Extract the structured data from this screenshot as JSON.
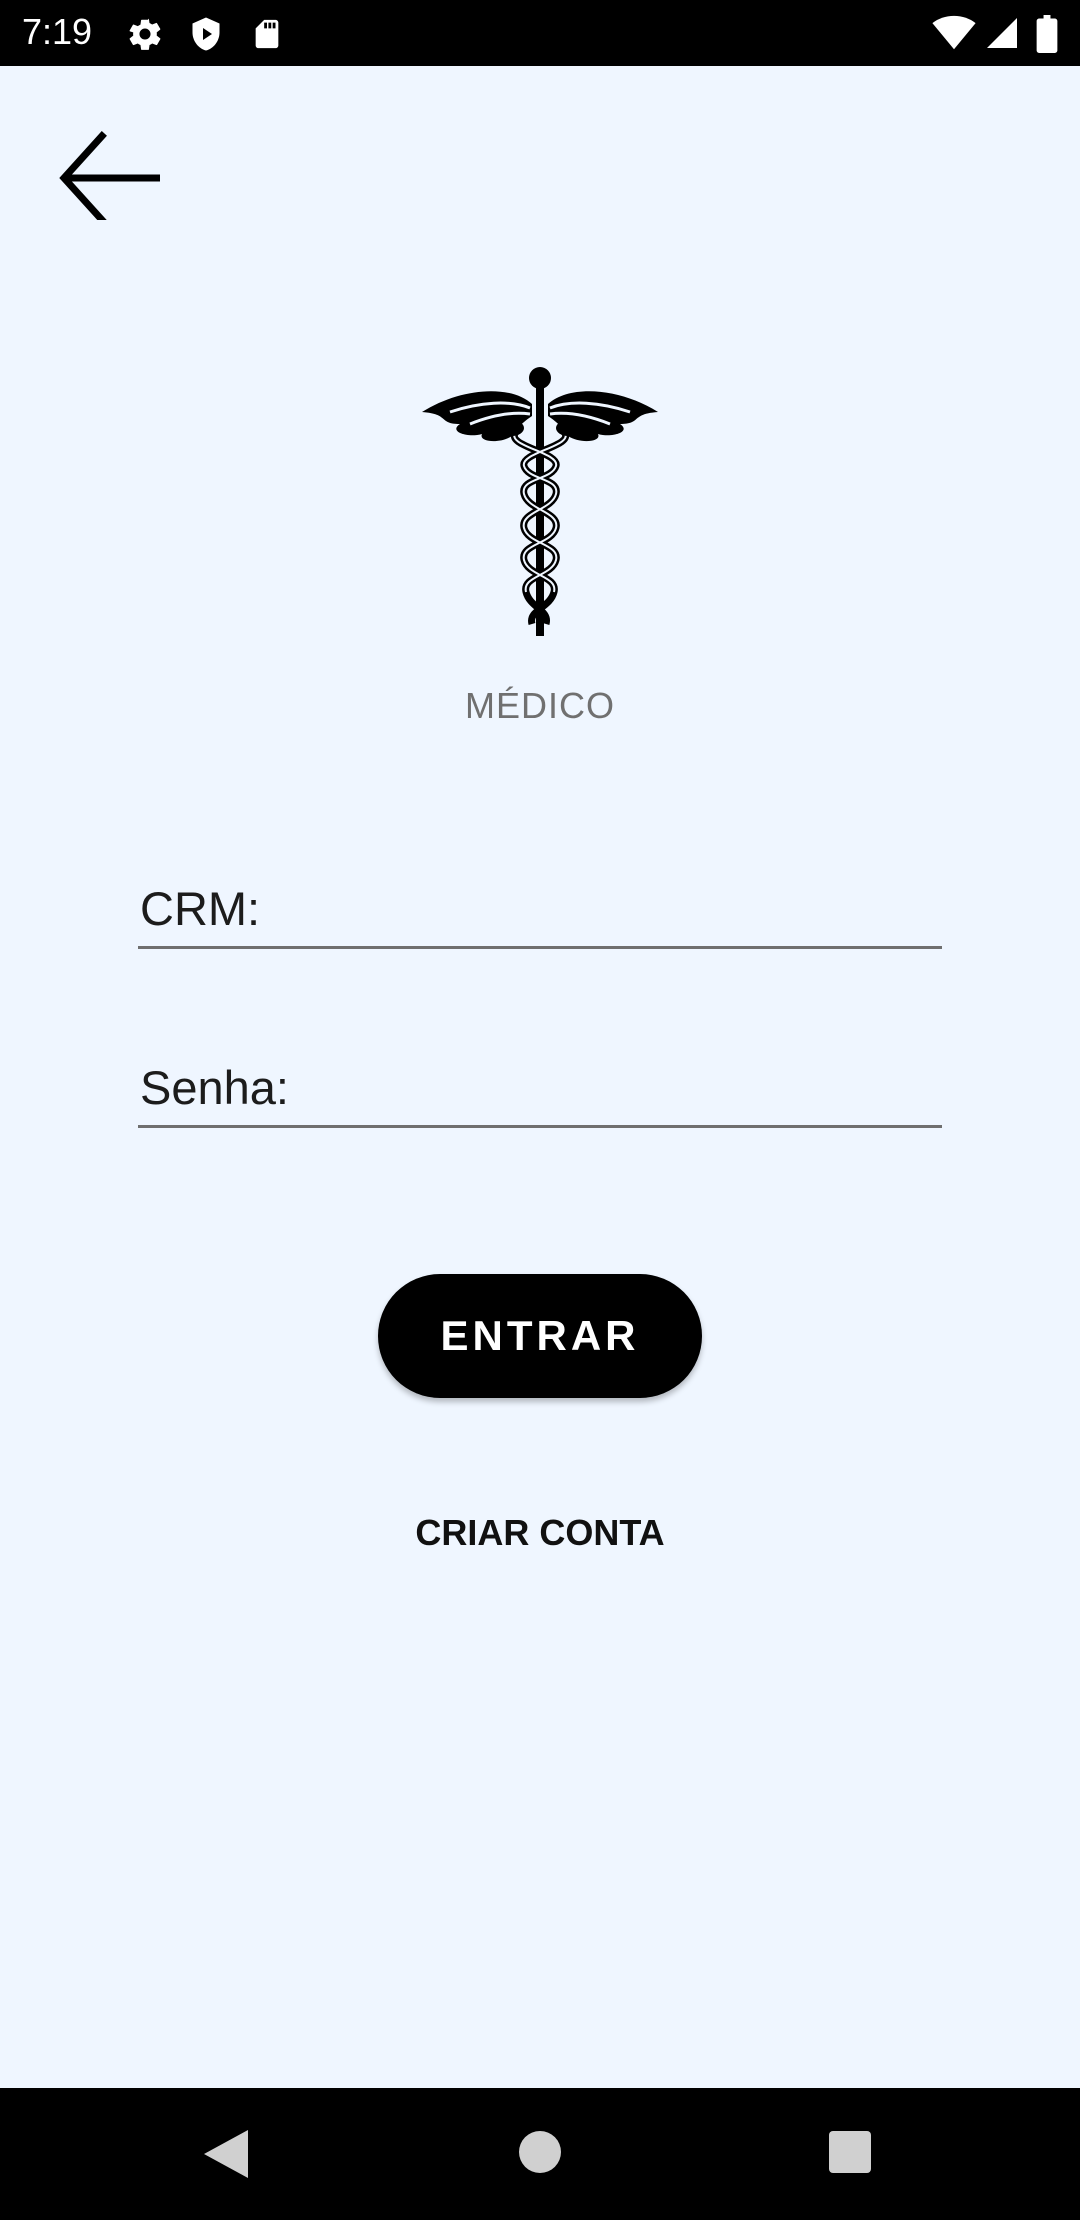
{
  "status_bar": {
    "time": "7:19",
    "left_icons": [
      "gear-icon",
      "shield-play-icon",
      "sd-card-icon"
    ],
    "right_icons": [
      "wifi-icon",
      "cell-signal-icon",
      "battery-icon"
    ]
  },
  "header": {
    "back_icon": "arrow-left-icon"
  },
  "logo": {
    "icon": "caduceus-icon",
    "label": "MÉDICO"
  },
  "form": {
    "crm_label": "CRM:",
    "crm_value": "",
    "senha_label": "Senha:",
    "senha_value": ""
  },
  "actions": {
    "login_label": "ENTRAR",
    "create_account_label": "CRIAR CONTA"
  },
  "nav_bar": {
    "icons": [
      "nav-back-icon",
      "nav-home-icon",
      "nav-recents-icon"
    ]
  },
  "colors": {
    "background": "#eff6ff",
    "primary_button": "#000000",
    "underline": "#6f6f6f"
  }
}
